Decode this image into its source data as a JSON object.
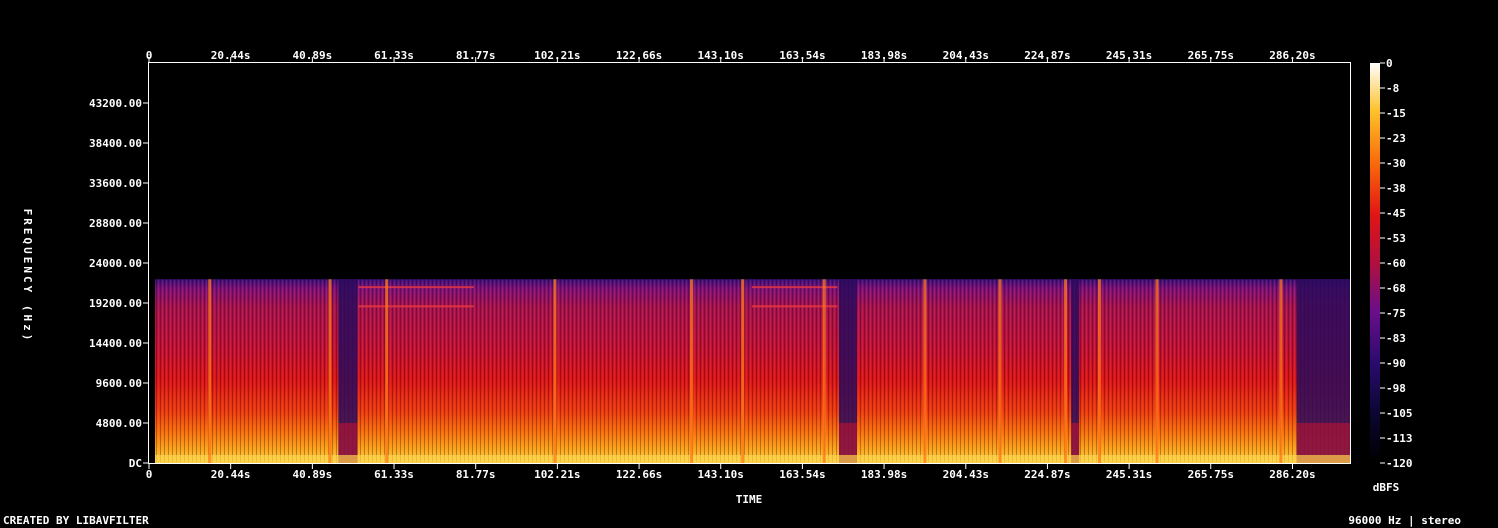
{
  "chart_data": {
    "type": "heatmap",
    "xlabel": "TIME",
    "ylabel": "FREQUENCY (Hz)",
    "x_ticks": [
      "0",
      "20.44s",
      "40.89s",
      "61.33s",
      "81.77s",
      "102.21s",
      "122.66s",
      "143.10s",
      "163.54s",
      "183.98s",
      "204.43s",
      "224.87s",
      "245.31s",
      "265.75s",
      "286.20s"
    ],
    "x_tick_seconds": [
      0,
      20.44,
      40.89,
      61.33,
      81.77,
      102.21,
      122.66,
      143.1,
      163.54,
      183.98,
      204.43,
      224.87,
      245.31,
      265.75,
      286.2
    ],
    "x_range_seconds": [
      0,
      300.6
    ],
    "y_ticks": [
      "DC",
      "4800.00",
      "9600.00",
      "14400.00",
      "19200.00",
      "24000.00",
      "28800.00",
      "33600.00",
      "38400.00",
      "43200.00"
    ],
    "y_tick_hz": [
      0,
      4800,
      9600,
      14400,
      19200,
      24000,
      28800,
      33600,
      38400,
      43200
    ],
    "y_range_hz": [
      0,
      48000
    ],
    "content_upper_hz": 22050,
    "colorbar": {
      "label": "dBFS",
      "ticks": [
        "0",
        "-8",
        "-15",
        "-23",
        "-30",
        "-38",
        "-45",
        "-53",
        "-60",
        "-68",
        "-75",
        "-83",
        "-90",
        "-98",
        "-105",
        "-113",
        "-120"
      ],
      "range_db": [
        -120,
        0
      ]
    },
    "loud_onsets_seconds": [
      15.2,
      45.3,
      59.5,
      101.6,
      135.8,
      148.6,
      169.0,
      194.2,
      213.0,
      229.4,
      237.9,
      252.3,
      283.3
    ],
    "quiet_gaps_seconds": [
      [
        47.4,
        52.2
      ],
      [
        172.7,
        177.2
      ],
      [
        230.8,
        232.8
      ],
      [
        287.3,
        300.6
      ]
    ],
    "horizontal_lines_hz": [
      18800,
      21100
    ],
    "horizontal_line_spans_seconds": [
      [
        52.4,
        81.3
      ],
      [
        150.9,
        172.3
      ]
    ],
    "grid": false
  },
  "footer": {
    "credit": "CREATED BY LIBAVFILTER",
    "info": "96000 Hz | stereo"
  }
}
